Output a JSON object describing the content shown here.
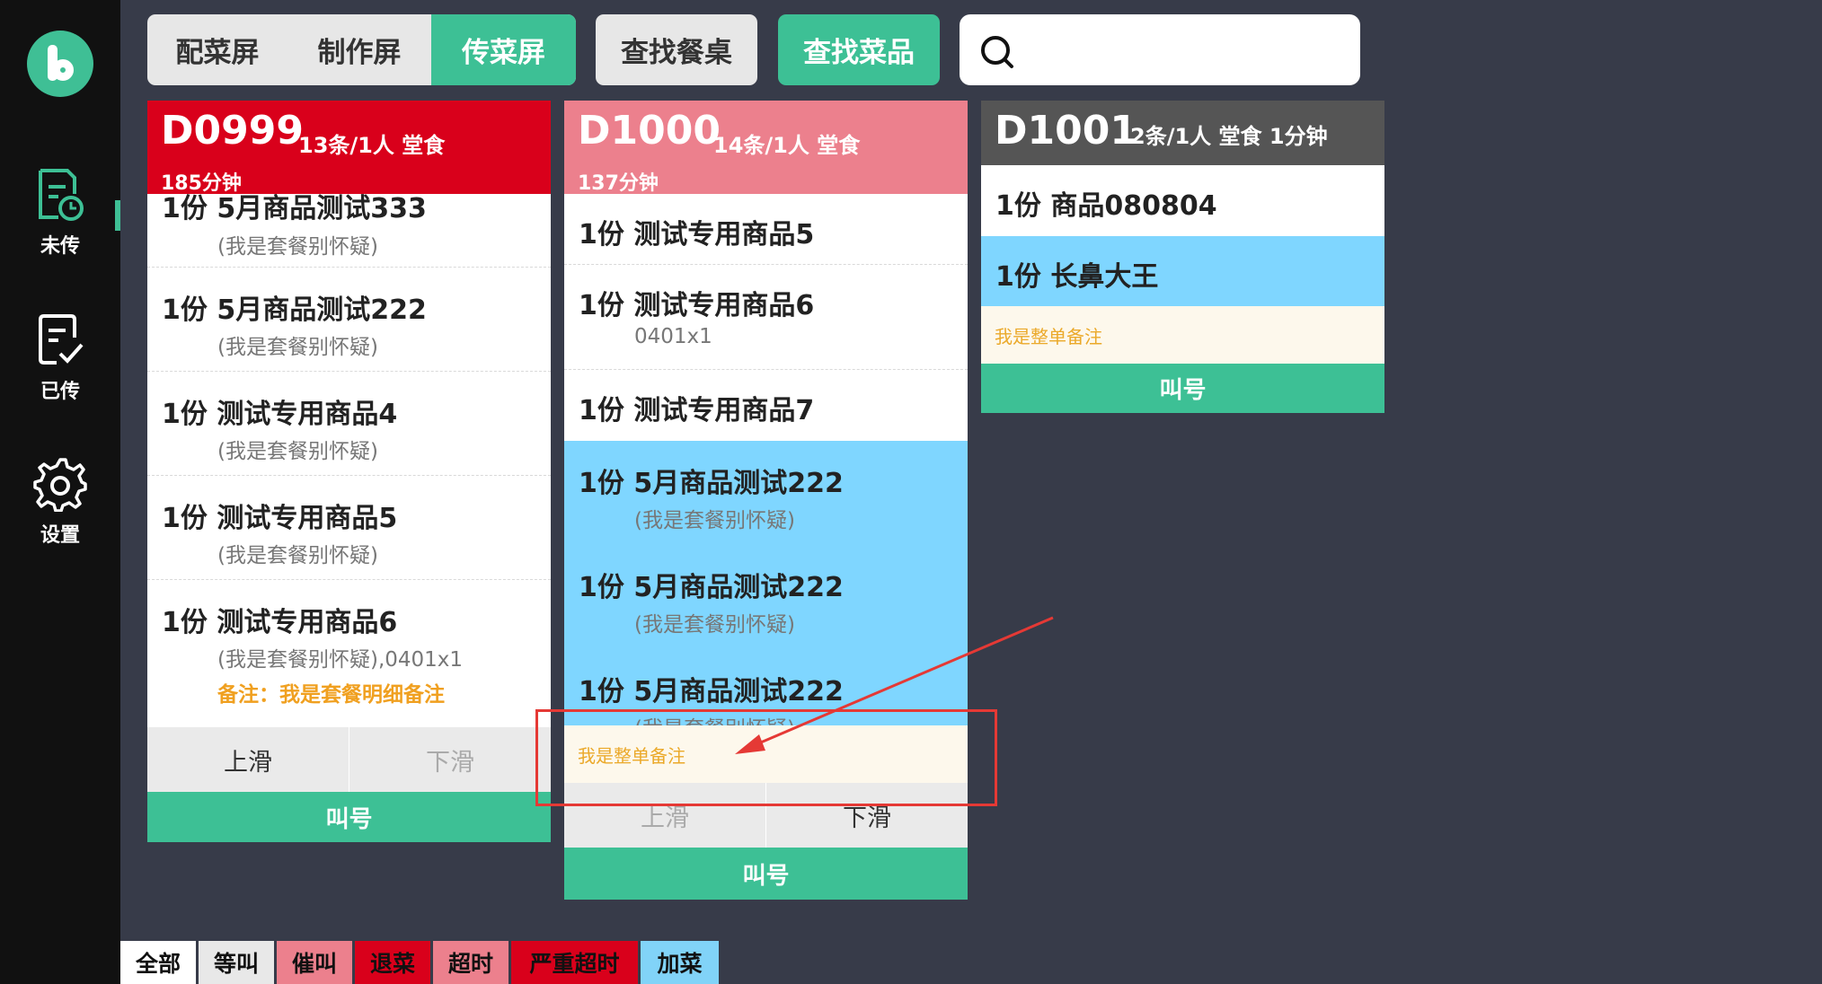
{
  "sidebar": {
    "nav": [
      {
        "label": "未传",
        "icon": "doc-clock-icon"
      },
      {
        "label": "已传",
        "icon": "doc-check-icon"
      },
      {
        "label": "设置",
        "icon": "gear-icon"
      }
    ]
  },
  "topbar": {
    "tabs": [
      "配菜屏",
      "制作屏",
      "传菜屏"
    ],
    "active_tab": "传菜屏",
    "find_table": "查找餐桌",
    "find_dish": "查找菜品",
    "search_value": ""
  },
  "colors": {
    "accent": "#3dc095",
    "urgent_red": "#d9001b",
    "rush_pink": "#ec808d",
    "neutral_grey": "#555555",
    "highlight_blue": "#7fd6ff",
    "note_orange": "#f0a020"
  },
  "orders": [
    {
      "table": "D0999",
      "meta": "13条/1人  堂食",
      "elapsed": "185分钟",
      "items": [
        {
          "name": "1份  5月商品测试333",
          "sub": "(我是套餐别怀疑)"
        },
        {
          "name": "1份  5月商品测试222",
          "sub": "(我是套餐别怀疑)"
        },
        {
          "name": "1份  测试专用商品4",
          "sub": "(我是套餐别怀疑)"
        },
        {
          "name": "1份  测试专用商品5",
          "sub": "(我是套餐别怀疑)"
        },
        {
          "name": "1份  测试专用商品6",
          "sub": "(我是套餐别怀疑),0401x1",
          "note": "备注：我是套餐明细备注"
        }
      ],
      "scroll_up": "上滑",
      "scroll_down": "下滑",
      "call": "叫号"
    },
    {
      "table": "D1000",
      "meta": "14条/1人  堂食",
      "elapsed": "137分钟",
      "items": [
        {
          "name": "1份  测试专用商品5"
        },
        {
          "name": "1份  测试专用商品6",
          "sub": "0401x1"
        },
        {
          "name": "1份  测试专用商品7"
        },
        {
          "name": "1份  5月商品测试222",
          "sub": "(我是套餐别怀疑)"
        },
        {
          "name": "1份  5月商品测试222",
          "sub": "(我是套餐别怀疑)"
        },
        {
          "name": "1份  5月商品测试222",
          "sub": "(我是套餐别怀疑)"
        }
      ],
      "remark": "我是整单备注",
      "scroll_up": "上滑",
      "scroll_down": "下滑",
      "call": "叫号"
    },
    {
      "table": "D1001",
      "meta": "2条/1人  堂食  1分钟",
      "items": [
        {
          "name": "1份  商品080804"
        },
        {
          "name": "1份  长鼻大王"
        }
      ],
      "remark": "我是整单备注",
      "call": "叫号"
    }
  ],
  "filters": [
    "全部",
    "等叫",
    "催叫",
    "退菜",
    "超时",
    "严重超时",
    "加菜"
  ]
}
